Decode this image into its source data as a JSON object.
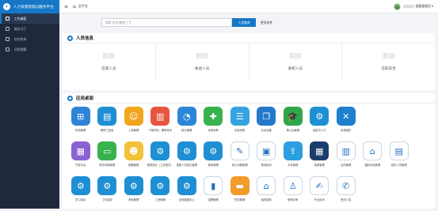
{
  "app": {
    "title": "人力资源管理与服务平台"
  },
  "sidebar": {
    "items": [
      {
        "label": "工作桌面",
        "active": true
      },
      {
        "label": "服务大厅",
        "active": false
      },
      {
        "label": "综合查询",
        "active": false
      },
      {
        "label": "消息提醒",
        "active": false
      }
    ]
  },
  "topbar": {
    "breadcrumb": "全平台",
    "username": "超级管理员 ▾"
  },
  "search": {
    "placeholder": "搜索 姓名/教职工号",
    "button": "人员查询",
    "more": "更多条件"
  },
  "people": {
    "title": "人员信息",
    "stats": [
      {
        "label": "在职人员"
      },
      {
        "label": "离退人员"
      },
      {
        "label": "离校人员"
      },
      {
        "label": "在职去世"
      }
    ]
  },
  "desktop": {
    "title": "应用桌面",
    "apps": [
      {
        "label": "机构管理",
        "color": "#2f84d6",
        "icon": "sitemap-icon",
        "glyph": "⊞"
      },
      {
        "label": "教职工信息",
        "color": "#1f8fd3",
        "icon": "archive-icon",
        "glyph": "▤"
      },
      {
        "label": "入事管理",
        "color": "#f3a51f",
        "icon": "user-icon",
        "glyph": "☺"
      },
      {
        "label": "干部任免、履职考评",
        "color": "#e8553e",
        "icon": "document-icon",
        "glyph": "▥"
      },
      {
        "label": "统计管理",
        "color": "#2a86d8",
        "icon": "pie-chart-icon",
        "glyph": "◔"
      },
      {
        "label": "师资培养",
        "color": "#37b24d",
        "icon": "plus-circle-icon",
        "glyph": "✚"
      },
      {
        "label": "绩效考核",
        "color": "#35a3e0",
        "icon": "clipboard-icon",
        "glyph": "☰"
      },
      {
        "label": "业绩合集",
        "color": "#2479c9",
        "icon": "book-icon",
        "glyph": "❐"
      },
      {
        "label": "博士后管理",
        "color": "#30a64a",
        "icon": "graduation-cap-icon",
        "glyph": "🎓"
      },
      {
        "label": "高层次人才",
        "color": "#1f8fd3",
        "icon": "gear-icon",
        "glyph": "⚙"
      },
      {
        "label": "系统维护",
        "color": "#1f7fd0",
        "icon": "tools-icon",
        "glyph": "✕"
      },
      {
        "label": "",
        "color": "",
        "icon": "",
        "glyph": ""
      },
      {
        "label": "",
        "color": "",
        "icon": "",
        "glyph": ""
      },
      {
        "label": "",
        "color": "",
        "icon": "",
        "glyph": ""
      },
      {
        "label": "开发平台",
        "color": "#8a63d2",
        "icon": "cart-icon",
        "glyph": "▦"
      },
      {
        "label": "职位申报管理",
        "color": "#37b24d",
        "icon": "monitor-icon",
        "glyph": "▭"
      },
      {
        "label": "薪酬管理",
        "color": "#f3c23a",
        "icon": "person-card-icon",
        "glyph": "☻"
      },
      {
        "label": "报表统计（工资相关）",
        "color": "#1f8fd3",
        "icon": "gear-icon",
        "glyph": "⚙"
      },
      {
        "label": "报表人员批位管理",
        "color": "#1f8fd3",
        "icon": "gear-icon",
        "glyph": "⚙"
      },
      {
        "label": "薪资管理",
        "color": "#1f8fd3",
        "icon": "gear-icon",
        "glyph": "⚙"
      },
      {
        "label": "统计请假管理",
        "color": "#ffffff",
        "icon": "edit-icon",
        "glyph": "✎"
      },
      {
        "label": "教师培训",
        "color": "#ffffff",
        "icon": "id-photo-icon",
        "glyph": "▣"
      },
      {
        "label": "文件管理",
        "color": "#2b9fe0",
        "icon": "upload-icon",
        "glyph": "⇪"
      },
      {
        "label": "档案管理",
        "color": "#1b3d6b",
        "icon": "grid-icon",
        "glyph": "▦"
      },
      {
        "label": "合同管理",
        "color": "#ffffff",
        "icon": "layout-icon",
        "glyph": "▥"
      },
      {
        "label": "福利补贴管理",
        "color": "#ffffff",
        "icon": "house-icon",
        "glyph": "⌂"
      },
      {
        "label": "临时人员管理",
        "color": "#ffffff",
        "icon": "id-card-icon",
        "glyph": "▤"
      },
      {
        "label": "",
        "color": "",
        "icon": "",
        "glyph": ""
      },
      {
        "label": "学习成绩",
        "color": "#1f8fd3",
        "icon": "gear-icon",
        "glyph": "⚙"
      },
      {
        "label": "工作成绩",
        "color": "#1f8fd3",
        "icon": "gear-icon",
        "glyph": "⚙"
      },
      {
        "label": "考勤管理",
        "color": "#1f8fd3",
        "icon": "gear-icon",
        "glyph": "⚙"
      },
      {
        "label": "工资管理",
        "color": "#1f8fd3",
        "icon": "gear-icon",
        "glyph": "⚙"
      },
      {
        "label": "绩效数据中心",
        "color": "#1f8fd3",
        "icon": "gear-icon",
        "glyph": "⚙"
      },
      {
        "label": "招聘管理",
        "color": "#ffffff",
        "icon": "bar-chart-icon",
        "glyph": "▮"
      },
      {
        "label": "任务管理",
        "color": "#f39b2a",
        "icon": "briefcase-icon",
        "glyph": "▬"
      },
      {
        "label": "组织架构",
        "color": "#ffffff",
        "icon": "house-person-icon",
        "glyph": "⌂"
      },
      {
        "label": "职称评审",
        "color": "#ffffff",
        "icon": "user-outline-icon",
        "glyph": "♙"
      },
      {
        "label": "专业技术",
        "color": "#ffffff",
        "icon": "signature-icon",
        "glyph": "✍"
      },
      {
        "label": "签约人员",
        "color": "#ffffff",
        "icon": "contact-icon",
        "glyph": "✆"
      }
    ]
  }
}
